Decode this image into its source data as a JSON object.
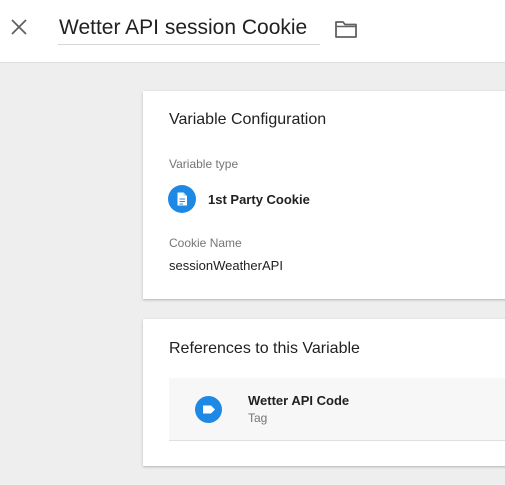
{
  "header": {
    "title": "Wetter API session Cookie",
    "close_icon": "close-icon",
    "folder_icon": "folder-icon"
  },
  "variable_config": {
    "heading": "Variable Configuration",
    "type_label": "Variable type",
    "type_name": "1st Party Cookie",
    "type_icon": "document-icon",
    "cookie_label": "Cookie Name",
    "cookie_value": "sessionWeatherAPI"
  },
  "references": {
    "heading": "References to this Variable",
    "items": [
      {
        "name": "Wetter API Code",
        "kind": "Tag",
        "icon": "tag-icon"
      }
    ]
  },
  "colors": {
    "accent": "#1e88e5",
    "background": "#eeeeee",
    "card": "#ffffff",
    "secondary_text": "#757575"
  }
}
